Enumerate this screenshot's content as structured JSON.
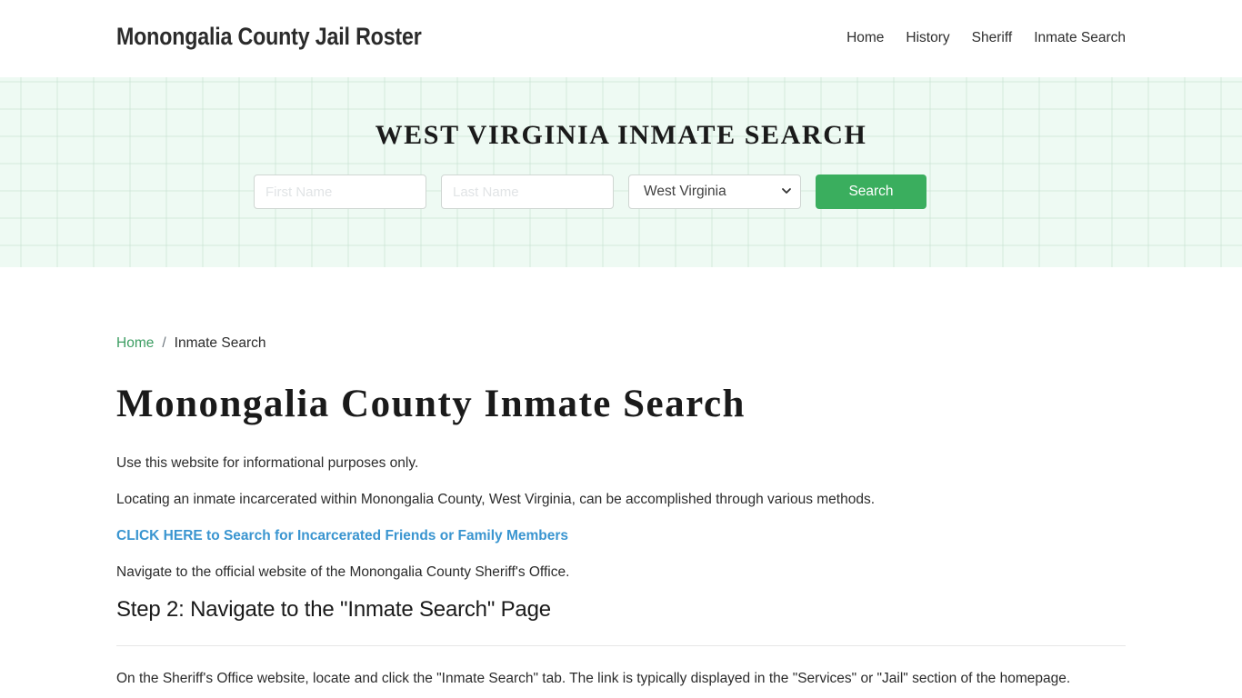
{
  "header": {
    "brand": "Monongalia County Jail Roster",
    "nav": [
      {
        "label": "Home"
      },
      {
        "label": "History"
      },
      {
        "label": "Sheriff"
      },
      {
        "label": "Inmate Search"
      }
    ]
  },
  "hero": {
    "title": "WEST VIRGINIA INMATE SEARCH",
    "first_name_placeholder": "First Name",
    "first_name_value": "",
    "last_name_placeholder": "Last Name",
    "last_name_value": "",
    "state_selected": "West Virginia",
    "search_label": "Search"
  },
  "breadcrumb": {
    "home": "Home",
    "separator": "/",
    "current": "Inmate Search"
  },
  "main": {
    "title": "Monongalia County Inmate Search",
    "para1": "Use this website for informational purposes only.",
    "para2": "Locating an inmate incarcerated within Monongalia County, West Virginia, can be accomplished through various methods.",
    "cta_link": "CLICK HERE to Search for Incarcerated Friends or Family Members",
    "para3": "Navigate to the official website of the Monongalia County Sheriff's Office.",
    "step2_title": "Step 2: Navigate to the \"Inmate Search\" Page",
    "para4": "On the Sheriff's Office website, locate and click the \"Inmate Search\" tab. The link is typically displayed in the \"Services\" or \"Jail\" section of the homepage."
  },
  "colors": {
    "accent_green": "#3aae5e",
    "link_green": "#3c9d62",
    "link_blue": "#3a95d0",
    "hero_bg": "#eefaf3"
  },
  "icons": {
    "select_chevron": "chevron-down-icon"
  }
}
